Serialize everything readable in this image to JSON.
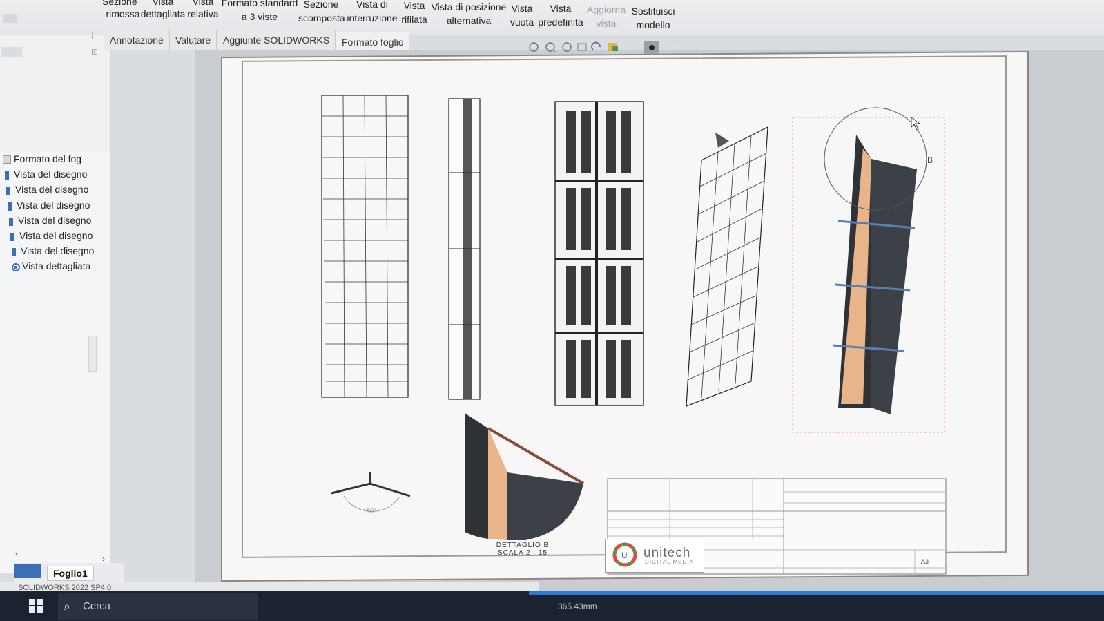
{
  "ribbon": {
    "items": [
      {
        "line1": "Sezione",
        "line2": "",
        "dim": false
      },
      {
        "line1": "Vista",
        "line2": "",
        "dim": false
      },
      {
        "line1": "Vista",
        "line2": "",
        "dim": false
      },
      {
        "line1": "Formato standard",
        "line2": "a 3 viste",
        "dim": false
      },
      {
        "line1": "Sezione",
        "line2": "scomposta",
        "dim": false
      },
      {
        "line1": "Vista di",
        "line2": "interruzione",
        "dim": false
      },
      {
        "line1": "Vista",
        "line2": "rifilata",
        "dim": false
      },
      {
        "line1": "Vista di posizione",
        "line2": "alternativa",
        "dim": false
      },
      {
        "line1": "Vista",
        "line2": "vuota",
        "dim": false
      },
      {
        "line1": "Vista",
        "line2": "predefinita",
        "dim": false
      },
      {
        "line1": "Aggiorna",
        "line2": "vista",
        "dim": true
      },
      {
        "line1": "Sostituisci",
        "line2": "modello",
        "dim": false
      }
    ],
    "partial_labels": [
      "rimossa",
      "dettagliata",
      "relativa"
    ]
  },
  "tabs": [
    "Annotazione",
    "Valutare",
    "Aggiunte SOLIDWORKS",
    "Formato foglio"
  ],
  "tree": {
    "items": [
      "Formato del fog",
      "Vista del disegno",
      "Vista del disegno",
      "Vista del disegno",
      "Vista del disegno",
      "Vista del disegno",
      "Vista del disegno",
      "Vista dettagliata"
    ]
  },
  "sheet_tab": {
    "label": "Foglio1"
  },
  "status": {
    "version": "SOLIDWORKS 2022 SP4.0",
    "coords": "365.43mm"
  },
  "taskbar": {
    "search_label": "Cerca"
  },
  "drawing": {
    "detail_label_line1": "DETTAGLIO B",
    "detail_label_line2": "SCALA 2 : 15",
    "detail_callout": "B",
    "angle_dim": "150°",
    "sheet_size": "A3",
    "logo_text": "unitech",
    "logo_sub": "DIGITAL MEDIA"
  },
  "colors": {
    "ribbon_bg": "#e6e8eb",
    "sheet_bg": "#f7f7f7",
    "accent_orange": "#e8a56d",
    "panel_dark": "#3d4148",
    "taskbar": "#1c2330"
  }
}
